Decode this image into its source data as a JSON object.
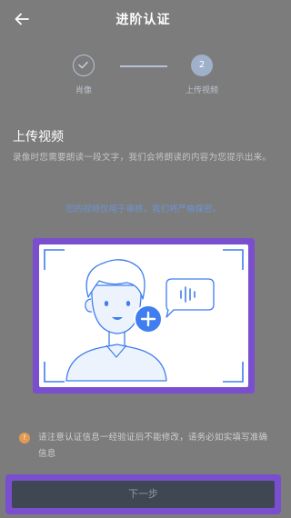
{
  "header": {
    "title": "进阶认证",
    "back_icon": "arrow-left-icon"
  },
  "steps": [
    {
      "label": "肖像",
      "state": "completed",
      "icon": "check-icon"
    },
    {
      "label": "上传视频",
      "state": "active",
      "number": "2"
    }
  ],
  "section": {
    "title": "上传视频",
    "description": "录像时您需要朗读一段文字，我们会将朗读的内容为您提示出来。",
    "notice": "您的视频仅用于审核，我们将严格保密。"
  },
  "upload": {
    "illustration": "person-speaking-illustration",
    "add_icon": "plus-icon",
    "voice_icon": "voice-wave-icon"
  },
  "tip": {
    "icon": "info-icon",
    "icon_glyph": "!",
    "text": "请注意认证信息一经验证后不能修改，请务必如实填写准确信息"
  },
  "footer": {
    "next_label": "下一步"
  },
  "colors": {
    "overlay": "#7c7c7c",
    "accent_blue": "#3f7df0",
    "highlight_purple": "#7a4fcf",
    "notice_blue": "#6c95d3",
    "tip_orange": "#e29a52"
  }
}
